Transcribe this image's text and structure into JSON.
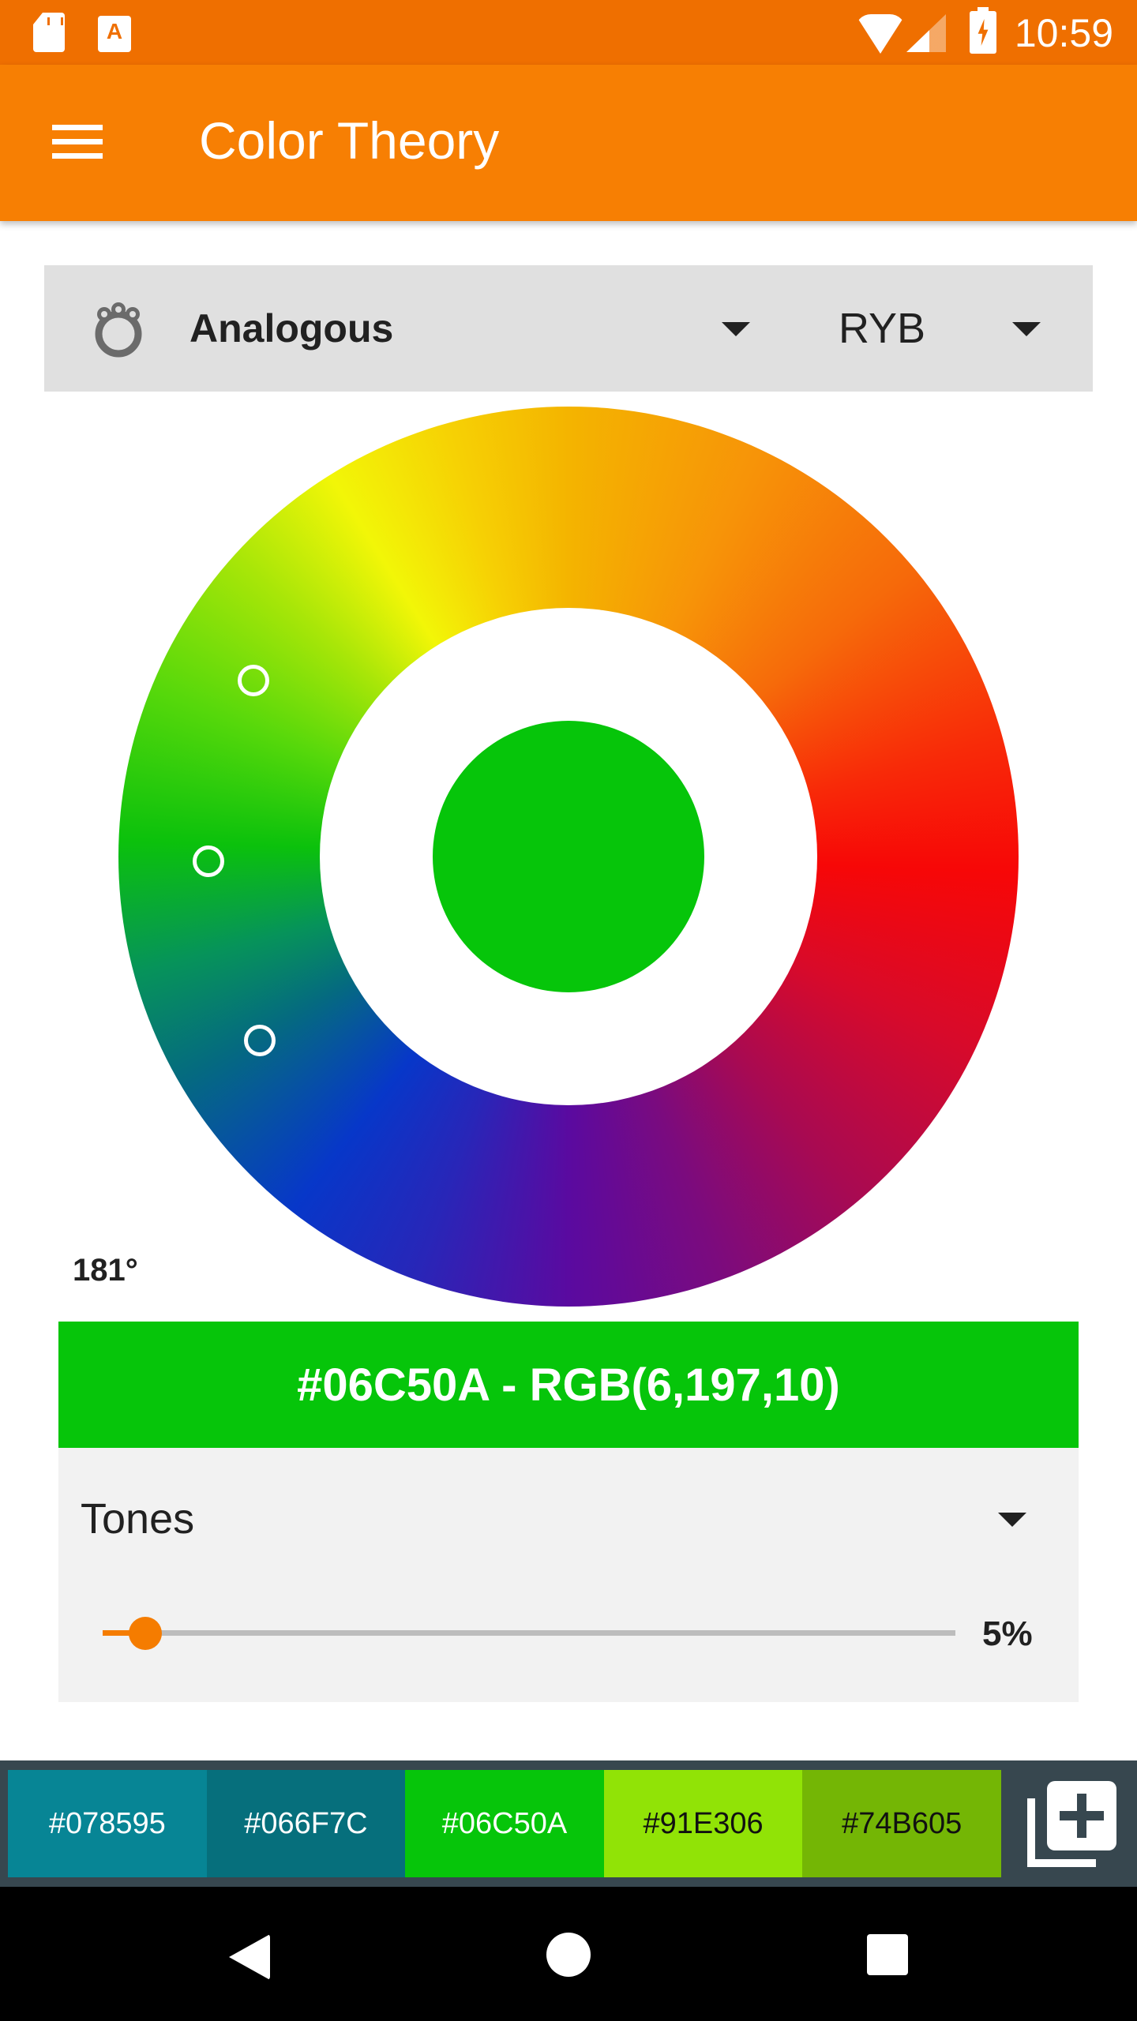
{
  "status_bar": {
    "time": "10:59",
    "icons": [
      "sd-card-icon",
      "a-notification-icon",
      "wifi-icon",
      "signal-icon",
      "battery-charging-icon"
    ],
    "a_icon_glyph": "A"
  },
  "app_bar": {
    "title": "Color Theory",
    "menu_icon": "hamburger-menu-icon"
  },
  "scheme_selector": {
    "icon": "analogous-ring-icon",
    "selected": "Analogous",
    "model_selected": "RYB"
  },
  "color_wheel": {
    "angle_label": "181°",
    "base_angle_deg": 181,
    "selected_color": "#06C50A",
    "marker_count": 3,
    "marker_colors": [
      "#91E306",
      "#06C50A",
      "#066F7C"
    ]
  },
  "color_info": {
    "text": "#06C50A - RGB(6,197,10)",
    "hex": "#06C50A",
    "rgb": [
      6,
      197,
      10
    ]
  },
  "tones": {
    "label": "Tones",
    "slider_value_percent": 5,
    "slider_value_label": "5%",
    "accent": "#F57C00"
  },
  "palette": {
    "swatches": [
      {
        "hex": "#078595",
        "label": "#078595",
        "text_color": "#ffffff"
      },
      {
        "hex": "#066F7C",
        "label": "#066F7C",
        "text_color": "#ffffff"
      },
      {
        "hex": "#06C50A",
        "label": "#06C50A",
        "text_color": "#ffffff"
      },
      {
        "hex": "#91E306",
        "label": "#91E306",
        "text_color": "#111111"
      },
      {
        "hex": "#74B605",
        "label": "#74B605",
        "text_color": "#111111"
      }
    ],
    "add_icon": "library-add-icon"
  },
  "nav_bar": {
    "buttons": [
      "back",
      "home",
      "recents"
    ]
  },
  "colors": {
    "status_bar": "#EF6F00",
    "app_bar": "#F77F03",
    "palette_bar": "#37474F"
  }
}
